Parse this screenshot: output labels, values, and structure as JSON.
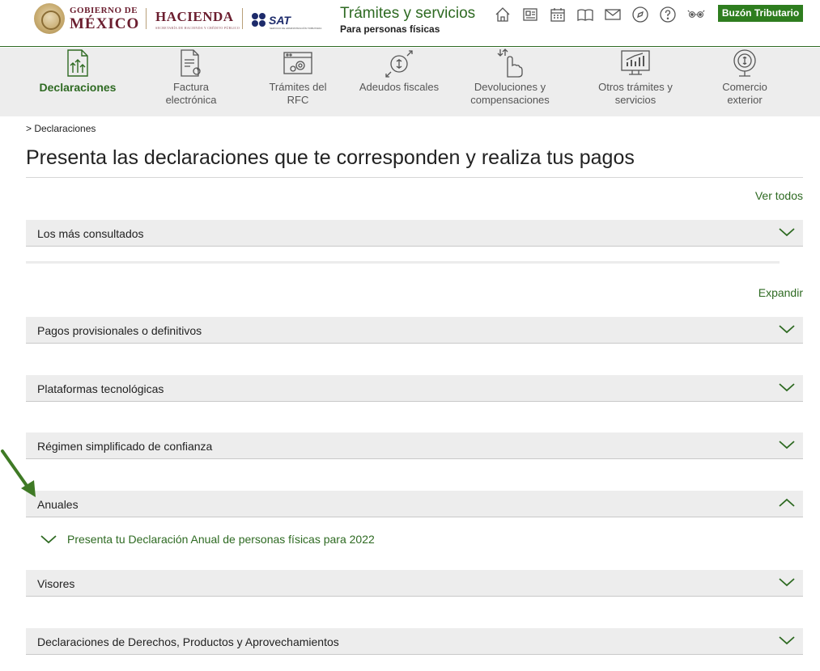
{
  "header": {
    "gob_line1": "GOBIERNO DE",
    "gob_line2": "MÉXICO",
    "hacienda": "HACIENDA",
    "hacienda_sub": "SECRETARÍA DE HACIENDA Y CRÉDITO PÚBLICO",
    "sat": "SAT",
    "sat_sub": "SERVICIO DE ADMINISTRACIÓN TRIBUTARIA",
    "title": "Trámites y servicios",
    "subtitle": "Para personas físicas",
    "icons": [
      "home-icon",
      "news-icon",
      "calendar-icon",
      "book-icon",
      "mail-icon",
      "compass-icon",
      "help-icon",
      "accessibility-icon"
    ],
    "buzon_label": "Buzón Tributario"
  },
  "nav": {
    "items": [
      {
        "label": "Declaraciones",
        "icon": "declaraciones-icon",
        "active": true
      },
      {
        "label": "Factura electrónica",
        "icon": "factura-icon",
        "active": false
      },
      {
        "label": "Trámites del RFC",
        "icon": "rfc-icon",
        "active": false
      },
      {
        "label": "Adeudos fiscales",
        "icon": "adeudos-icon",
        "active": false
      },
      {
        "label": "Devoluciones y compensaciones",
        "icon": "devoluciones-icon",
        "active": false
      },
      {
        "label": "Otros trámites y servicios",
        "icon": "otros-tramites-icon",
        "active": false
      },
      {
        "label": "Comercio exterior",
        "icon": "comercio-exterior-icon",
        "active": false
      }
    ]
  },
  "main": {
    "breadcrumb": "> Declaraciones",
    "title": "Presenta las declaraciones que te corresponden y realiza tus pagos",
    "ver_todos": "Ver todos",
    "expandir": "Expandir",
    "accordions": [
      {
        "title": "Los más consultados",
        "expanded": false
      },
      {
        "title": "Pagos provisionales o definitivos",
        "expanded": false
      },
      {
        "title": "Plataformas tecnológicas",
        "expanded": false
      },
      {
        "title": "Régimen simplificado de confianza",
        "expanded": false
      },
      {
        "title": "Anuales",
        "expanded": true
      },
      {
        "title": "Visores",
        "expanded": false
      },
      {
        "title": "Declaraciones de Derechos, Productos y Aprovechamientos",
        "expanded": false
      }
    ],
    "anuales_item": "Presenta tu Declaración Anual de personas físicas para 2022"
  },
  "colors": {
    "brand_green": "#2e6a22",
    "buzon_green": "#2e7d1f",
    "gob_maroon": "#6b1e2f",
    "sat_blue": "#1d2b6b",
    "panel_gray": "#ededed"
  }
}
